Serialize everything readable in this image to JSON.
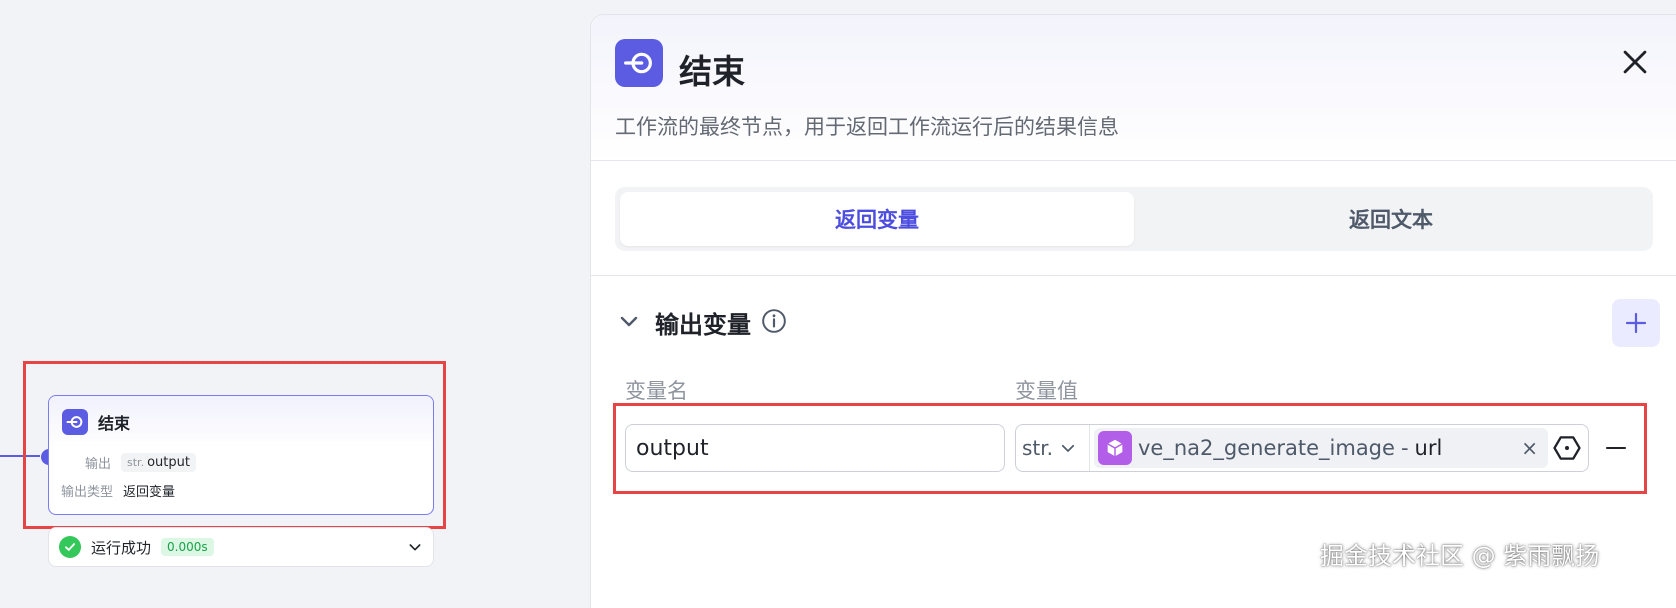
{
  "canvas": {
    "node": {
      "title": "结束",
      "output_label": "输出",
      "output_type_tag": "str.",
      "output_var": "output",
      "output_kind_label": "输出类型",
      "output_kind_value": "返回变量"
    },
    "status": {
      "text": "运行成功",
      "time": "0.000s"
    }
  },
  "panel": {
    "title": "结束",
    "description": "工作流的最终节点，用于返回工作流运行后的结果信息",
    "tabs": [
      {
        "label": "返回变量",
        "active": true
      },
      {
        "label": "返回文本",
        "active": false
      }
    ],
    "section_title": "输出变量",
    "columns": {
      "name": "变量名",
      "value": "变量值"
    },
    "row": {
      "name_value": "output",
      "type": "str.",
      "ref_node": "ve_na2_generate_image",
      "ref_sep": "-",
      "ref_field": "url",
      "clear": "×"
    }
  },
  "watermark": "掘金技术社区 @ 紫雨飘扬",
  "colors": {
    "accent": "#5b5ce2",
    "highlight": "#e64545",
    "success": "#34c759",
    "cube": "#b25ee8"
  }
}
